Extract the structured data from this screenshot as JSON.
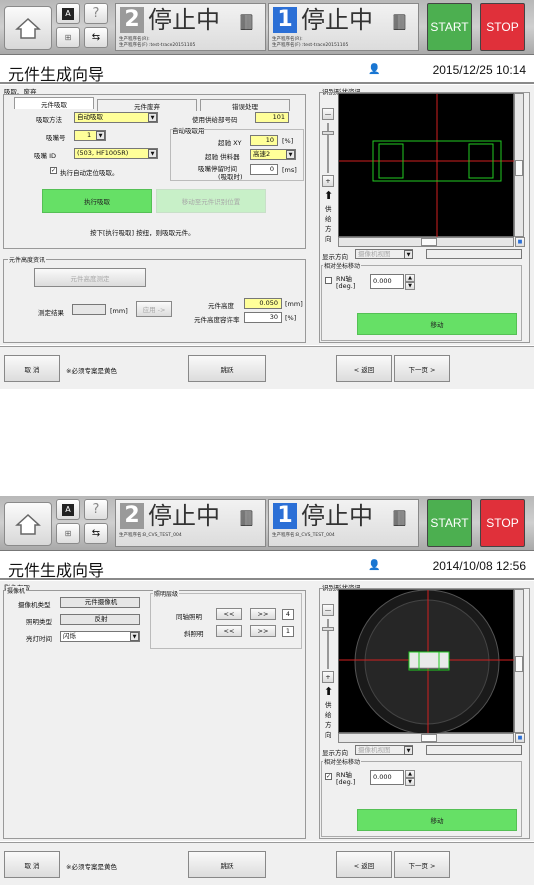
{
  "top": {
    "title": "元件生成向导",
    "datetime": "2015/12/25 10:14",
    "status1_num": "2",
    "status1_text": "停止中",
    "status1_prog": "生产程序名(R):\n生产程序名(F) :test-trace20151105",
    "status2_num": "1",
    "status2_text": "停止中",
    "status2_prog": "生产程序名(R):\n生产程序名(F) :test-trace20151105",
    "start": "START",
    "stop": "STOP"
  },
  "left": {
    "section": "吸取、废弃",
    "tabs": [
      "元件吸取",
      "元件废弃",
      "错误处理"
    ],
    "pick_method_label": "吸取方法",
    "pick_method_value": "自动吸取",
    "nozzle_no_label": "吸嘴号",
    "nozzle_no_value": "1",
    "nozzle_id_label": "吸嘴 ID",
    "nozzle_id_value": "(503, HF1005R)",
    "auto_pos_label": "执行自动定位吸取。",
    "feeder_label": "使用供给部号码",
    "feeder_value": "101",
    "auto_group_label": "自动吸取用",
    "xy_label": "超驰 XY",
    "xy_value": "10",
    "xy_unit": "[%]",
    "supply_label": "超驰 供料器",
    "supply_value": "高速2",
    "dwell_label": "吸嘴停留时间",
    "dwell_label2": "(吸取时)",
    "dwell_value": "0",
    "dwell_unit": "[ms]",
    "exec_btn": "执行吸取",
    "move_btn": "移动至元件识别位置",
    "hint": "按下[执行吸取] 按纽，则吸取元件。",
    "height_group": "元件高度资讯",
    "height_btn": "元件高度测定",
    "result_label": "测定结果",
    "result_unit": "[mm]",
    "apply_btn": "应用 ->",
    "part_height_label": "元件高度",
    "part_height_value": "0.050",
    "part_height_unit": "[mm]",
    "tolerance_label": "元件高度容许率",
    "tolerance_value": "30",
    "tolerance_unit": "[%]"
  },
  "right": {
    "section": "识别形状资讯",
    "supply_dir": [
      "供",
      "给",
      "方",
      "向"
    ],
    "display_dir_label": "显示方向",
    "display_dir_value": "摄像机视图",
    "rel_move_label": "相对坐标移动",
    "rn_label": "RN轴",
    "rn_unit": "[deg.]",
    "rn_value": "0.000",
    "move_btn": "移动"
  },
  "bottom": {
    "cancel": "取 消",
    "note": "※必须专案是黄色",
    "skip": "跳跃",
    "back": "< 返回",
    "next": "下一页 >"
  },
  "top2": {
    "title": "元件生成向导",
    "datetime": "2014/10/08 12:56",
    "status1_num": "2",
    "status1_text": "停止中",
    "status1_prog": "生产程序名:B_CVS_TEST_004",
    "status2_num": "1",
    "status2_text": "停止中",
    "status2_prog": "生产程序名:B_CVS_TEST_004",
    "start": "START",
    "stop": "STOP"
  },
  "left2": {
    "section": "影像存取",
    "camera_group": "摄像机",
    "camera_type_label": "摄像机类型",
    "camera_type_value": "元件摄像机",
    "light_type_label": "照明类型",
    "light_type_value": "反射",
    "light_time_label": "亮灯时间",
    "light_time_value": "闪烁",
    "light_level_group": "照明层级",
    "coax_label": "同轴照明",
    "coax_value": "4",
    "oblique_label": "斜照明",
    "oblique_value": "1",
    "dec": "<<",
    "inc": ">>"
  },
  "right2": {
    "section": "识别形状资讯",
    "supply_dir": [
      "供",
      "给",
      "方",
      "向"
    ],
    "display_dir_label": "显示方向",
    "display_dir_value": "摄像机视图",
    "rel_move_label": "相对坐标移动",
    "rn_label": "RN轴",
    "rn_unit": "[deg.]",
    "rn_value": "0.000",
    "move_btn": "移动"
  },
  "bottom2": {
    "cancel": "取 消",
    "note": "※必须专案是黄色",
    "skip": "跳跃",
    "back": "< 返回",
    "next": "下一页 >"
  },
  "colors": {
    "status_blue": "#2b6fd6",
    "status_grey": "#9a9a9a",
    "start_green": "#4caf50",
    "stop_red": "#e0303a",
    "required_yellow": "#ffff99",
    "action_green": "#66e066",
    "overlay_green": "#22cc22",
    "crosshair_red": "#d02020"
  }
}
